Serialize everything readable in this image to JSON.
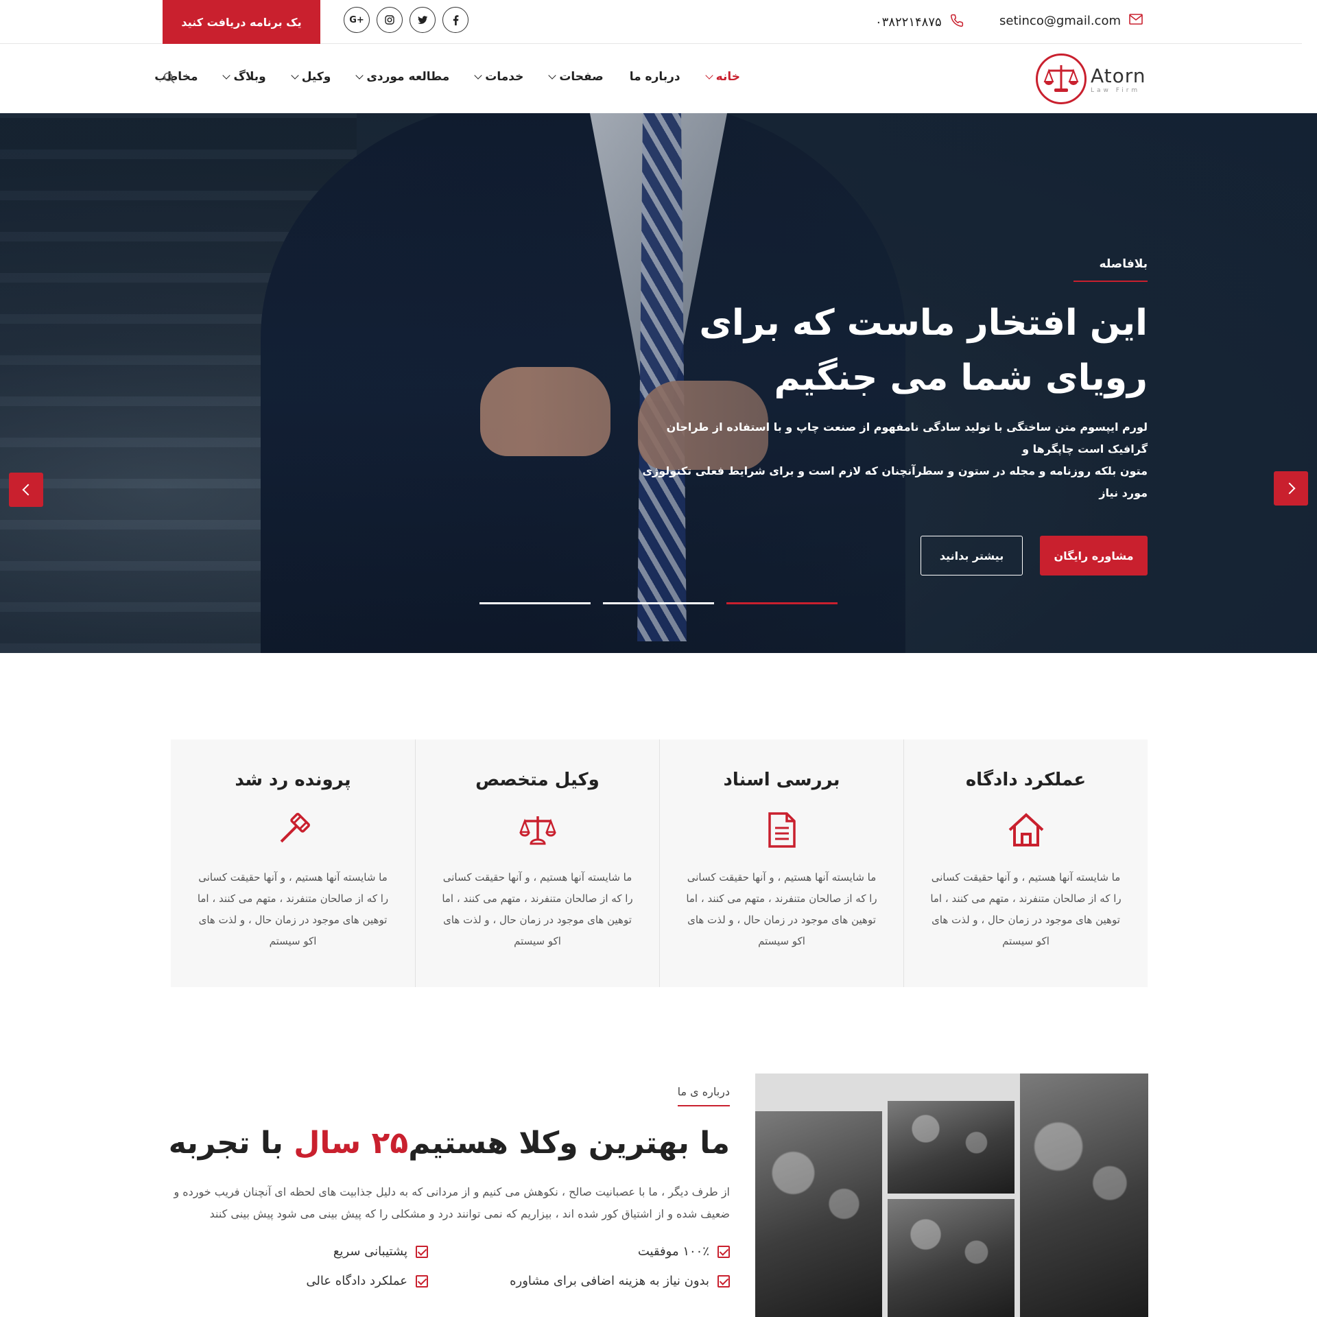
{
  "topbar": {
    "cta_label": "یک برنامه دریافت کنید",
    "socials": [
      "G+",
      "instagram",
      "twitter",
      "facebook"
    ],
    "phone": "۰۳۸۲۲۱۴۸۷۵",
    "email": "setinco@gmail.com"
  },
  "brand": {
    "name": "Atorn",
    "tagline": "Law Firm",
    "accent": "#c9202e"
  },
  "nav": {
    "items": [
      {
        "label": "خانه",
        "dropdown": true,
        "active": true
      },
      {
        "label": "درباره ما",
        "dropdown": false,
        "active": false
      },
      {
        "label": "صفحات",
        "dropdown": true,
        "active": false
      },
      {
        "label": "خدمات",
        "dropdown": true,
        "active": false
      },
      {
        "label": "مطالعه موردی",
        "dropdown": true,
        "active": false
      },
      {
        "label": "وکیل",
        "dropdown": true,
        "active": false
      },
      {
        "label": "وبلاگ",
        "dropdown": true,
        "active": false
      },
      {
        "label": "مخاطب",
        "dropdown": false,
        "active": false
      }
    ]
  },
  "hero": {
    "eyebrow": "بلافاصله",
    "title_line1": "این افتخار ماست که برای",
    "title_line2": "رویای شما می جنگیم",
    "text_line1": "لورم ایپسوم متن ساختگی با تولید سادگی نامفهوم از صنعت چاپ و با استفاده از طراحان گرافیک است چاپگرها و",
    "text_line2": "متون بلکه روزنامه و مجله در ستون و سطرآنچنان که لازم است و برای شرایط فعلی تکنولوژی مورد نیاز",
    "primary_button": "مشاوره رایگان",
    "secondary_button": "بیشتر بدانید",
    "slide_count": 3,
    "active_slide": 3
  },
  "features": [
    {
      "title": "عملکرد دادگاه",
      "icon": "house-icon",
      "text": "ما شایسته آنها هستیم ، و آنها حقیقت کسانی را که از صالحان متنفرند ، متهم می کنند ، اما توهین های موجود در زمان حال ، و لذت های اکو سیستم"
    },
    {
      "title": "بررسی اسناد",
      "icon": "document-icon",
      "text": "ما شایسته آنها هستیم ، و آنها حقیقت کسانی را که از صالحان متنفرند ، متهم می کنند ، اما توهین های موجود در زمان حال ، و لذت های اکو سیستم"
    },
    {
      "title": "وکیل متخصص",
      "icon": "scales-icon",
      "text": "ما شایسته آنها هستیم ، و آنها حقیقت کسانی را که از صالحان متنفرند ، متهم می کنند ، اما توهین های موجود در زمان حال ، و لذت های اکو سیستم"
    },
    {
      "title": "پرونده رد شد",
      "icon": "gavel-icon",
      "text": "ما شایسته آنها هستیم ، و آنها حقیقت کسانی را که از صالحان متنفرند ، متهم می کنند ، اما توهین های موجود در زمان حال ، و لذت های اکو سیستم"
    }
  ],
  "about": {
    "eyebrow": "درباره ی ما",
    "title_part1": "ما بهترین وکلا هستیم",
    "title_highlight": "۲۵ سال",
    "title_part2": "با تجربه",
    "text_line1": "از طرف دیگر ، ما با عصبانیت صالح ، نکوهش می کنیم و از مردانی که به دلیل جذابیت های لحظه ای آنچنان فریب خورده و",
    "text_line2": "ضعیف شده و از اشتیاق کور شده اند ، بیزاریم که نمی توانند درد و مشکلی را که پیش بینی می شود پیش بینی کنند",
    "checks": [
      "۱۰۰٪ موفقیت",
      "پشتیبانی سریع",
      "بدون نیاز به هزینه اضافی برای مشاوره",
      "عملکرد دادگاه عالی"
    ]
  }
}
